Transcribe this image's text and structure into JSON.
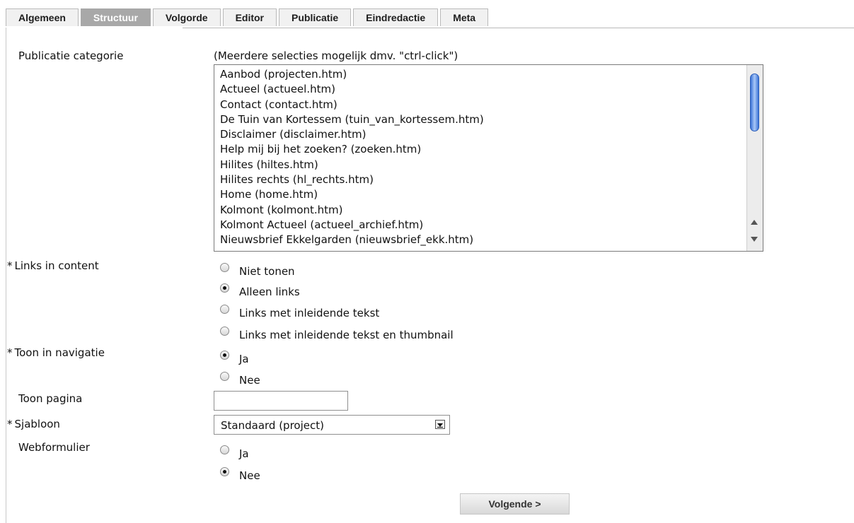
{
  "tabs": [
    "Algemeen",
    "Structuur",
    "Volgorde",
    "Editor",
    "Publicatie",
    "Eindredactie",
    "Meta"
  ],
  "active_tab": "Structuur",
  "category": {
    "label": "Publicatie categorie",
    "hint": "(Meerdere selecties mogelijk dmv. \"ctrl-click\")",
    "options": [
      "Aanbod (projecten.htm)",
      "Actueel (actueel.htm)",
      "Contact (contact.htm)",
      "De Tuin van Kortessem (tuin_van_kortessem.htm)",
      "Disclaimer (disclaimer.htm)",
      "Help mij bij het zoeken? (zoeken.htm)",
      "Hilites (hiltes.htm)",
      "Hilites rechts (hl_rechts.htm)",
      "Home (home.htm)",
      "Kolmont (kolmont.htm)",
      "Kolmont Actueel (actueel_archief.htm)",
      "Nieuwsbrief Ekkelgarden (nieuwsbrief_ekk.htm)"
    ]
  },
  "links": {
    "label": "Links in content",
    "required": "*",
    "options": [
      "Niet tonen",
      "Alleen links",
      "Links met inleidende tekst",
      "Links met inleidende tekst en thumbnail"
    ],
    "selected": "Alleen links"
  },
  "nav": {
    "label": "Toon in navigatie",
    "required": "*",
    "options": [
      "Ja",
      "Nee"
    ],
    "selected": "Ja"
  },
  "page": {
    "label": "Toon pagina",
    "value": ""
  },
  "template": {
    "label": "Sjabloon",
    "required": "*",
    "value": "Standaard (project)"
  },
  "webform": {
    "label": "Webformulier",
    "options": [
      "Ja",
      "Nee"
    ],
    "selected": "Nee"
  },
  "next_button": "Volgende >"
}
